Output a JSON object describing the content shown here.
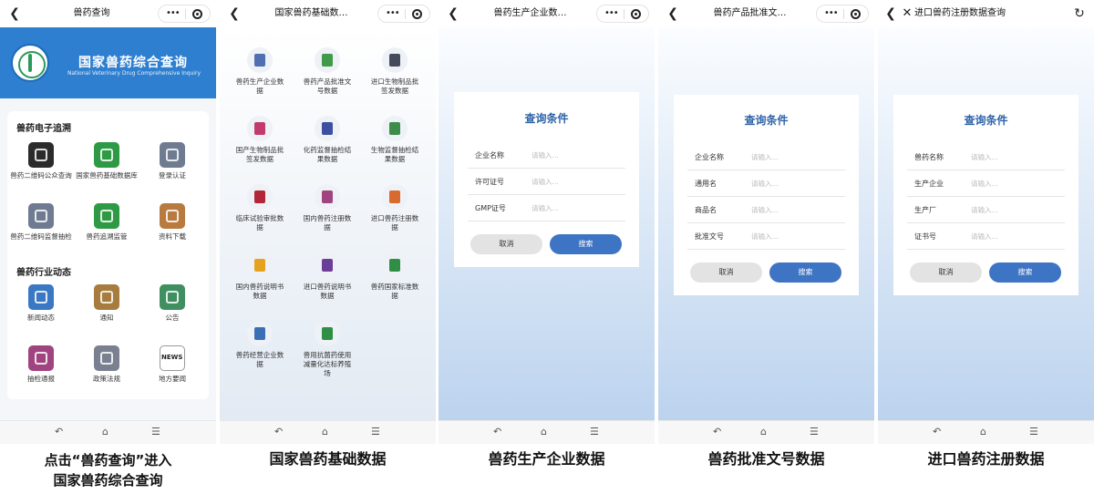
{
  "screens": [
    {
      "title": "兽药查询",
      "caption": "点击“兽药查询”进入\n国家兽药综合查询"
    },
    {
      "title": "国家兽药基础数…",
      "caption": "国家兽药基础数据"
    },
    {
      "title": "兽药生产企业数…",
      "caption": "兽药生产企业数据"
    },
    {
      "title": "兽药产品批准文…",
      "caption": "兽药批准文号数据"
    },
    {
      "title": "进口兽药注册数据查询",
      "caption": "进口兽药注册数据"
    }
  ],
  "banner": {
    "title": "国家兽药综合查询",
    "subtitle": "National Veterinary Drug Comprehensive Inquiry"
  },
  "home": {
    "sections": [
      {
        "title": "兽药电子追溯",
        "items": [
          {
            "label": "兽药二维码公众查询",
            "icon": "qr-code-icon",
            "color": "#2b2b2b"
          },
          {
            "label": "国家兽药基础数据库",
            "icon": "database-plus-icon",
            "color": "#2f9a45"
          },
          {
            "label": "登录认证",
            "icon": "users-icon",
            "color": "#6f7b91"
          },
          {
            "label": "兽药二维码监督抽检",
            "icon": "document-check-icon",
            "color": "#6f7b91"
          },
          {
            "label": "兽药追溯监管",
            "icon": "fingerprint-icon",
            "color": "#2f9a45"
          },
          {
            "label": "资料下载",
            "icon": "download-icon",
            "color": "#b97a3f"
          }
        ]
      },
      {
        "title": "兽药行业动态",
        "items": [
          {
            "label": "新闻动态",
            "icon": "globe-icon",
            "color": "#3a78c3"
          },
          {
            "label": "通知",
            "icon": "notice-board-icon",
            "color": "#a77c3f"
          },
          {
            "label": "公告",
            "icon": "announcement-icon",
            "color": "#3f8f60"
          },
          {
            "label": "抽检通报",
            "icon": "printer-icon",
            "color": "#a0437e"
          },
          {
            "label": "政策法规",
            "icon": "books-icon",
            "color": "#7a8090"
          },
          {
            "label": "地方要闻",
            "icon": "newspaper-icon",
            "color": "#9a9a9a"
          }
        ]
      }
    ],
    "news_glyph": "NEWS"
  },
  "basic_items": [
    {
      "label": "兽药生产企业数据",
      "icon": "factory-icon",
      "color": "#4f6fb0"
    },
    {
      "label": "兽药产品批准文号数据",
      "icon": "stamp-icon",
      "color": "#3f9a4a"
    },
    {
      "label": "进口生物制品批签发数据",
      "icon": "clipboard-check-icon",
      "color": "#444c5c"
    },
    {
      "label": "国产生物制品批签发数据",
      "icon": "clipboard-edit-icon",
      "color": "#c33b6a"
    },
    {
      "label": "化药监督抽检结果数据",
      "icon": "flask-icon",
      "color": "#3c4fa0"
    },
    {
      "label": "生物监督抽检结果数据",
      "icon": "syringe-icon",
      "color": "#3c8c4a"
    },
    {
      "label": "临床试验审批数据",
      "icon": "approval-icon",
      "color": "#b3263a"
    },
    {
      "label": "国内兽药注册数据",
      "icon": "register-icon",
      "color": "#a0437e"
    },
    {
      "label": "进口兽药注册数据",
      "icon": "import-card-icon",
      "color": "#d9692c"
    },
    {
      "label": "国内兽药说明书数据",
      "icon": "manual-icon",
      "color": "#e6a21e"
    },
    {
      "label": "进口兽药说明书数据",
      "icon": "manual-w-icon",
      "color": "#6b3e9a"
    },
    {
      "label": "兽药国家标准数据",
      "icon": "standard-icon",
      "color": "#2f8f45"
    },
    {
      "label": "兽药经营企业数据",
      "icon": "monitor-chart-icon",
      "color": "#3a6fb5"
    },
    {
      "label": "兽用抗菌药使用减量化达标养殖场",
      "icon": "medicine-bottle-icon",
      "color": "#2f8f45"
    }
  ],
  "queries": [
    {
      "title": "查询条件",
      "fields": [
        {
          "label": "企业名称",
          "placeholder": "请输入..."
        },
        {
          "label": "许可证号",
          "placeholder": "请输入..."
        },
        {
          "label": "GMP证号",
          "placeholder": "请输入..."
        }
      ],
      "cancel": "取消",
      "search": "搜索"
    },
    {
      "title": "查询条件",
      "fields": [
        {
          "label": "企业名称",
          "placeholder": "请输入..."
        },
        {
          "label": "通用名",
          "placeholder": "请输入..."
        },
        {
          "label": "商品名",
          "placeholder": "请输入..."
        },
        {
          "label": "批准文号",
          "placeholder": "请输入..."
        }
      ],
      "cancel": "取消",
      "search": "搜索"
    },
    {
      "title": "查询条件",
      "fields": [
        {
          "label": "兽药名称",
          "placeholder": "请输入..."
        },
        {
          "label": "生产企业",
          "placeholder": "请输入..."
        },
        {
          "label": "生产厂",
          "placeholder": "请输入..."
        },
        {
          "label": "证书号",
          "placeholder": "请输入..."
        }
      ],
      "cancel": "取消",
      "search": "搜索"
    }
  ],
  "colors": {
    "accent": "#3e74c4",
    "banner": "#2f7fd0",
    "title": "#2e63a8"
  }
}
